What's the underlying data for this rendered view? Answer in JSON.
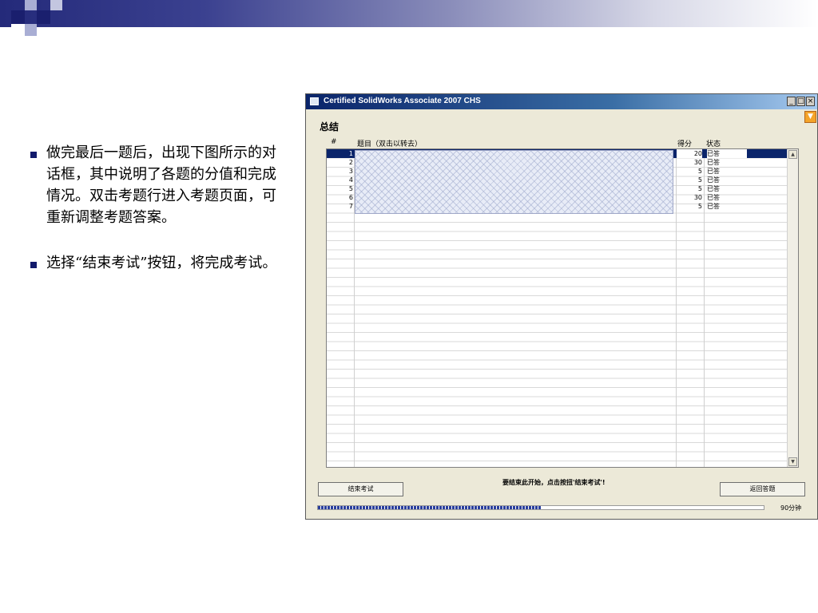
{
  "slide": {
    "bullets": [
      "做完最后一题后，出现下图所示的对话框，其中说明了各题的分值和完成情况。双击考题行进入考题页面，可重新调整考题答案。",
      "选择“结束考试”按钮，将完成考试。"
    ],
    "colors": {
      "accent": "#1a1f6e",
      "band_end": "#ffffff"
    }
  },
  "dialog": {
    "title": "Certified SolidWorks Associate 2007 CHS",
    "title_buttons": [
      "_",
      "□",
      "×"
    ],
    "flag_icon": "flag-icon",
    "summary_title": "总结",
    "columns": {
      "num": "#",
      "question": "题目（双击以转去）",
      "score": "得分",
      "status": "状态"
    },
    "rows": [
      {
        "num": "1",
        "score": "20",
        "status": "已答"
      },
      {
        "num": "2",
        "score": "30",
        "status": "已答"
      },
      {
        "num": "3",
        "score": "5",
        "status": "已答"
      },
      {
        "num": "4",
        "score": "5",
        "status": "已答"
      },
      {
        "num": "5",
        "score": "5",
        "status": "已答"
      },
      {
        "num": "6",
        "score": "30",
        "status": "已答"
      },
      {
        "num": "7",
        "score": "5",
        "status": "已答"
      }
    ],
    "hint": "要结束此开始，点击按扭'结束考试'!",
    "end_button": "结束考试",
    "return_button": "返回答题",
    "progress": 0.5,
    "timer": "90分钟"
  }
}
